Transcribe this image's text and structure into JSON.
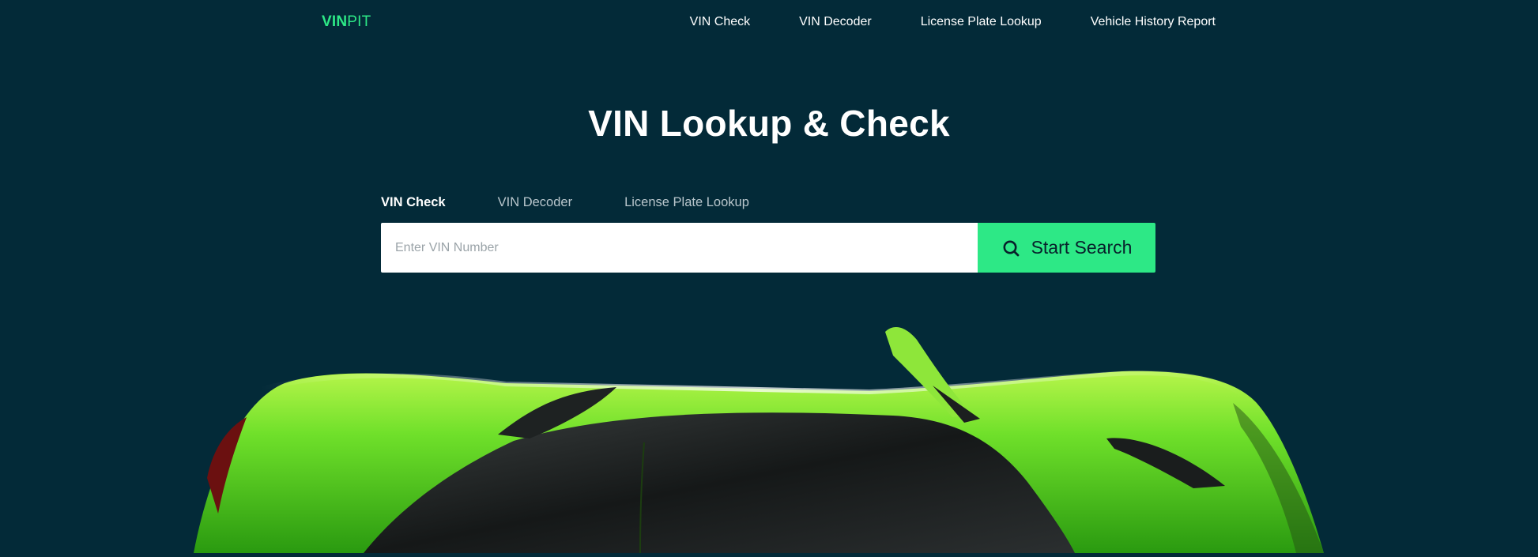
{
  "header": {
    "logo_bold": "VIN",
    "logo_light": "PIT",
    "nav": [
      {
        "label": "VIN Check"
      },
      {
        "label": "VIN Decoder"
      },
      {
        "label": "License Plate Lookup"
      },
      {
        "label": "Vehicle History Report"
      }
    ]
  },
  "hero": {
    "title": "VIN Lookup & Check",
    "tabs": [
      {
        "label": "VIN Check",
        "active": true
      },
      {
        "label": "VIN Decoder",
        "active": false
      },
      {
        "label": "License Plate Lookup",
        "active": false
      }
    ],
    "search": {
      "placeholder": "Enter VIN Number",
      "value": "",
      "button_label": "Start Search",
      "button_icon": "search-icon"
    },
    "image": "green-sports-car-top-view"
  },
  "colors": {
    "background": "#032a38",
    "accent": "#2de886",
    "text": "#ffffff"
  }
}
